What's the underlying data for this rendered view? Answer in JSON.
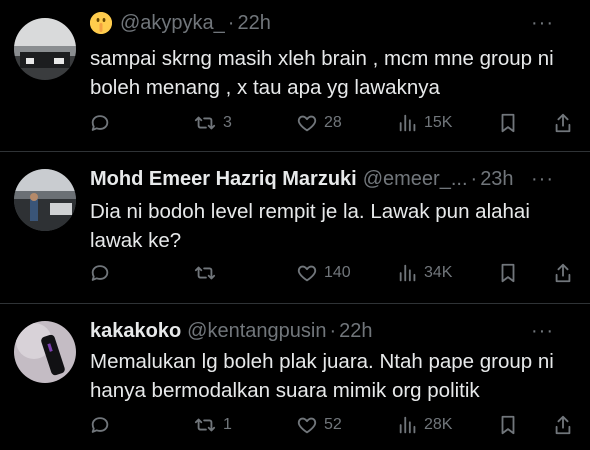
{
  "tweets": [
    {
      "name": "",
      "handle": "@akypyka_",
      "time": "22h",
      "text": "sampai skrng masih xleh brain , mcm mne group ni boleh menang , x tau apa yg lawaknya",
      "replies": "",
      "retweets": "3",
      "likes": "28",
      "views": "15K",
      "more": "···"
    },
    {
      "name": "Mohd Emeer Hazriq Marzuki",
      "handle": "@emeer_...",
      "time": "23h",
      "text": "Dia ni bodoh level rempit je la. Lawak pun alahai lawak ke?",
      "replies": "",
      "retweets": "",
      "likes": "140",
      "views": "34K",
      "more": "···"
    },
    {
      "name": "kakakoko",
      "handle": "@kentangpusin",
      "time": "22h",
      "text": "Memalukan lg boleh plak juara. Ntah pape group ni hanya bermodalkan suara mimik org politik",
      "replies": "",
      "retweets": "1",
      "likes": "52",
      "views": "28K",
      "more": "···"
    }
  ],
  "separator": "·"
}
